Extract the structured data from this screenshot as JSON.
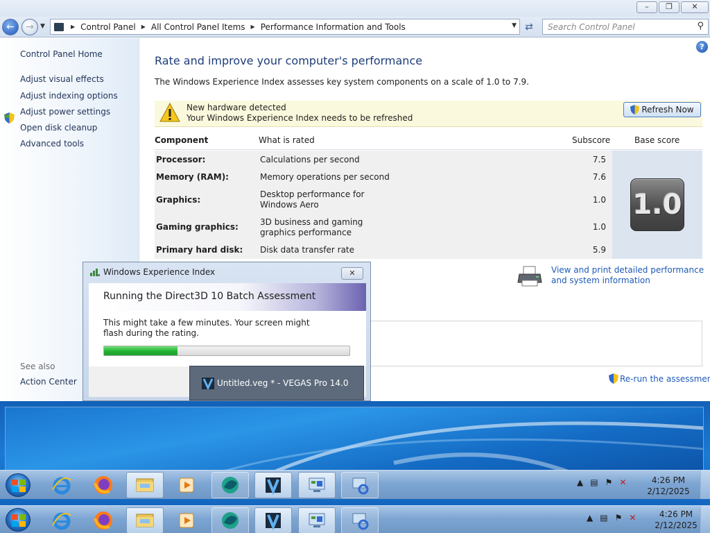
{
  "window": {
    "breadcrumb": [
      "Control Panel",
      "All Control Panel Items",
      "Performance Information and Tools"
    ],
    "search_placeholder": "Search Control Panel"
  },
  "sidebar": {
    "home": "Control Panel Home",
    "links": [
      "Adjust visual effects",
      "Adjust indexing options",
      "Adjust power settings",
      "Open disk cleanup",
      "Advanced tools"
    ],
    "see_also_label": "See also",
    "see_also_links": [
      "Action Center"
    ]
  },
  "main": {
    "title": "Rate and improve your computer's performance",
    "intro": "The Windows Experience Index assesses key system components on a scale of 1.0 to 7.9.",
    "notice": {
      "line1": "New hardware detected",
      "line2": "Your Windows Experience Index needs to be refreshed",
      "button": "Refresh Now"
    },
    "table": {
      "headers": {
        "component": "Component",
        "what": "What is rated",
        "subscore": "Subscore",
        "base": "Base score"
      },
      "rows": [
        {
          "component": "Processor:",
          "what": "Calculations per second",
          "subscore": "7.5"
        },
        {
          "component": "Memory (RAM):",
          "what": "Memory operations per second",
          "subscore": "7.6"
        },
        {
          "component": "Graphics:",
          "what": "Desktop performance for Windows Aero",
          "subscore": "1.0"
        },
        {
          "component": "Gaming graphics:",
          "what": "3D business and gaming graphics performance",
          "subscore": "1.0"
        },
        {
          "component": "Primary hard disk:",
          "what": "Disk data transfer rate",
          "subscore": "5.9"
        }
      ],
      "base_score": "1.0"
    },
    "print_link": "View and print detailed performance and system information",
    "rerun_link": "Re-run the assessment"
  },
  "dialog": {
    "title": "Windows Experience Index",
    "heading": "Running the Direct3D 10 Batch Assessment",
    "message": "This might take a few minutes. Your screen might flash during the rating.",
    "progress": 0.3
  },
  "thumbnail": {
    "title": "Untitled.veg * - VEGAS Pro 14.0"
  },
  "taskbar": {
    "time": "4:26 PM",
    "date": "2/12/2025",
    "apps": [
      "internet-explorer",
      "firefox",
      "file-explorer",
      "media-player",
      "browser-app",
      "vegas-pro",
      "control-panel",
      "windows-update"
    ]
  },
  "colors": {
    "link": "#1e5bb8",
    "title": "#1e3d7a",
    "progress": "#22b032",
    "notice_bg": "#fbf9dd"
  }
}
